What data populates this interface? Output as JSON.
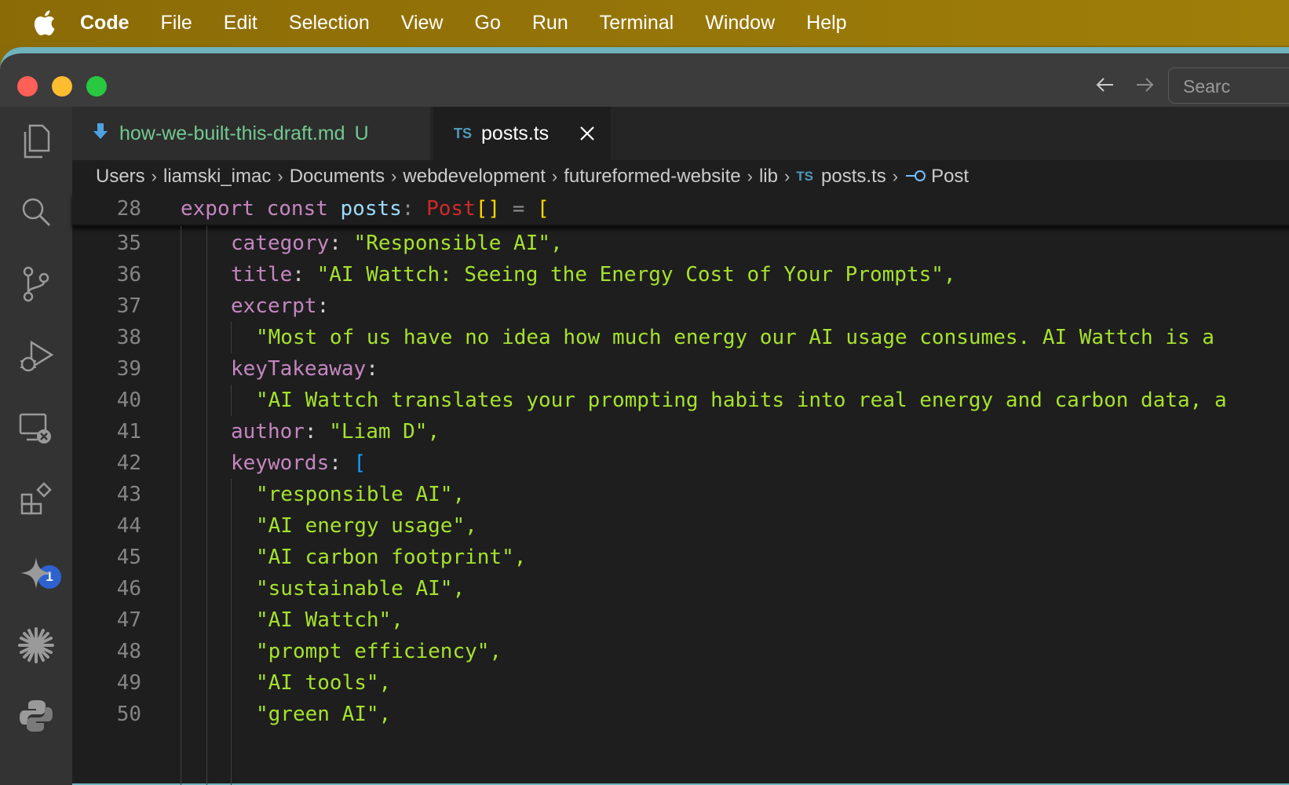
{
  "menubar": {
    "app": "Code",
    "items": [
      "File",
      "Edit",
      "Selection",
      "View",
      "Go",
      "Run",
      "Terminal",
      "Window",
      "Help"
    ]
  },
  "titlebar": {
    "search_placeholder": "Searc"
  },
  "tabs": [
    {
      "label": "how-we-built-this-draft.md",
      "status": "U",
      "icon": "markdown-arrow-icon"
    },
    {
      "label": "posts.ts",
      "lang": "TS",
      "active": true
    }
  ],
  "breadcrumb": {
    "items": [
      "Users",
      "liamski_imac",
      "Documents",
      "webdevelopment",
      "futureformed-website",
      "lib"
    ],
    "file_lang": "TS",
    "file": "posts.ts",
    "symbol": "Post"
  },
  "activity_badge": "1",
  "sticky": {
    "line": "28",
    "kw1": "export",
    "kw2": "const",
    "name": "posts",
    "colon": ":",
    "type": "Post",
    "brackets": "[]",
    "eq": "=",
    "open": "["
  },
  "code": [
    {
      "n": "35",
      "prop": "category",
      "value": "\"Responsible AI\","
    },
    {
      "n": "36",
      "prop": "title",
      "value": "\"AI Wattch: Seeing the Energy Cost of Your Prompts\","
    },
    {
      "n": "37",
      "prop": "excerpt",
      "value": ""
    },
    {
      "n": "38",
      "value": "\"Most of us have no idea how much energy our AI usage consumes. AI Wattch is a"
    },
    {
      "n": "39",
      "prop": "keyTakeaway",
      "value": ""
    },
    {
      "n": "40",
      "value": "\"AI Wattch translates your prompting habits into real energy and carbon data, a"
    },
    {
      "n": "41",
      "prop": "author",
      "value": "\"Liam D\","
    },
    {
      "n": "42",
      "prop": "keywords",
      "value": "["
    },
    {
      "n": "43",
      "value": "\"responsible AI\","
    },
    {
      "n": "44",
      "value": "\"AI energy usage\","
    },
    {
      "n": "45",
      "value": "\"AI carbon footprint\","
    },
    {
      "n": "46",
      "value": "\"sustainable AI\","
    },
    {
      "n": "47",
      "value": "\"AI Wattch\","
    },
    {
      "n": "48",
      "value": "\"prompt efficiency\","
    },
    {
      "n": "49",
      "value": "\"AI tools\","
    },
    {
      "n": "50",
      "value": "\"green AI\","
    }
  ]
}
